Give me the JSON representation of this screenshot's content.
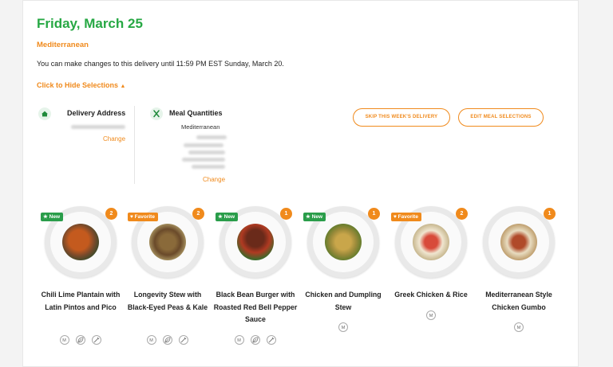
{
  "header": {
    "date": "Friday, March 25",
    "plan": "Mediterranean",
    "notice": "You can make changes to this delivery until 11:59 PM EST Sunday, March 20.",
    "hide_link": "Click to Hide Selections"
  },
  "delivery": {
    "title": "Delivery Address",
    "change": "Change",
    "icon": "home-icon"
  },
  "quantities": {
    "title": "Meal Quantities",
    "plan": "Mediterranean",
    "change": "Change",
    "icon": "utensils-icon"
  },
  "actions": {
    "skip": "SKIP THIS WEEK'S DELIVERY",
    "edit": "EDIT MEAL SELECTIONS"
  },
  "meals": [
    {
      "name": "Chili Lime Plantain with Latin Pintos and Pico",
      "tag": "New",
      "qty": "2",
      "attributes": [
        "M",
        "leaf",
        "pepper"
      ]
    },
    {
      "name": "Longevity Stew with Black-Eyed Peas & Kale",
      "tag": "Favorite",
      "qty": "2",
      "attributes": [
        "M",
        "leaf",
        "pepper"
      ]
    },
    {
      "name": "Black Bean Burger with Roasted Red Bell Pepper Sauce",
      "tag": "New",
      "qty": "1",
      "attributes": [
        "M",
        "leaf",
        "pepper"
      ]
    },
    {
      "name": "Chicken and Dumpling Stew",
      "tag": "New",
      "qty": "1",
      "attributes": [
        "M"
      ]
    },
    {
      "name": "Greek Chicken & Rice",
      "tag": "Favorite",
      "qty": "2",
      "attributes": [
        "M"
      ]
    },
    {
      "name": "Mediterranean Style Chicken Gumbo",
      "tag": "",
      "qty": "1",
      "attributes": [
        "M"
      ]
    }
  ],
  "colors": {
    "accent": "#f08a1c",
    "brand_green": "#27a844",
    "tag_new": "#2a9d4a"
  }
}
